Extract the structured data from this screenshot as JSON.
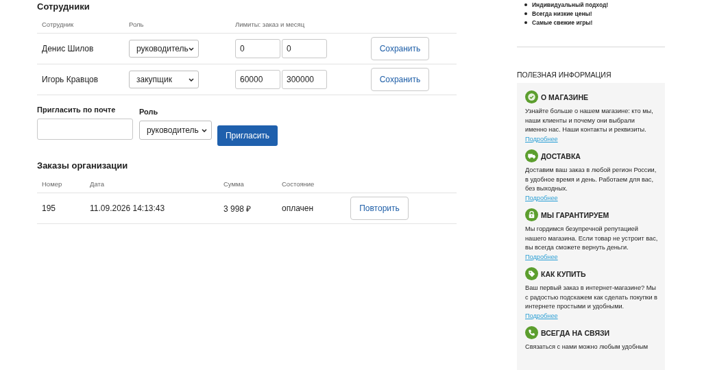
{
  "employees": {
    "title": "Сотрудники",
    "columns": [
      "Сотрудник",
      "Роль",
      "Лимиты: заказ и месяц"
    ],
    "rows": [
      {
        "name": "Денис Шилов",
        "role": "руководитель",
        "order_limit": "0",
        "month_limit": "0",
        "button": "Сохранить"
      },
      {
        "name": "Игорь Кравцов",
        "role": "закупщик",
        "order_limit": "60000",
        "month_limit": "300000",
        "button": "Сохранить"
      }
    ]
  },
  "invite": {
    "email_label": "Пригласить по почте",
    "role_label": "Роль",
    "role": "руководитель",
    "button": "Пригласить"
  },
  "orders": {
    "title": "Заказы организации",
    "columns": [
      "Номер",
      "Дата",
      "Сумма",
      "Состояние"
    ],
    "rows": [
      {
        "number": "195",
        "date": "11.09.2026 14:13:43",
        "sum": "3 998 ₽",
        "status": "оплачен",
        "button": "Повторить"
      }
    ]
  },
  "sidebar": {
    "bullets": [
      "Индивидуальный подход!",
      "Всегда низкие цены!",
      "Самые свежие игры!"
    ],
    "useful_info": {
      "title": "ПОЛЕЗНАЯ ИНФОРМАЦИЯ",
      "items": [
        {
          "kind": "check",
          "title": "О МАГАЗИНЕ",
          "text": "Узнайте больше о нашем магазине: кто мы, наши клиенты и почему они выбрали именно нас. Наши контакты и реквизиты.",
          "link": "Подробнее"
        },
        {
          "kind": "truck",
          "title": "ДОСТАВКА",
          "text": "Доставим ваш заказ в любой регион России, в удобное время и день. Работаем для вас, без выходных.",
          "link": "Подробнее"
        },
        {
          "kind": "lock",
          "title": "МЫ ГАРАНТИРУЕМ",
          "text": "Мы гордимся безупречной репутацией нашего магазина. Если товар не устроит вас, вы всегда сможете вернуть деньги.",
          "link": "Подробнее"
        },
        {
          "kind": "tag",
          "title": "КАК КУПИТЬ",
          "text": "Ваш первый заказ в интернет-магазине? Мы с радостью подскажем как сделать покупки в интернете простыми и удобными.",
          "link": "Подробнее"
        },
        {
          "kind": "phone",
          "title": "ВСЕГДА НА СВЯЗИ",
          "text": "Связаться с нами можно любым удобным"
        }
      ]
    }
  }
}
